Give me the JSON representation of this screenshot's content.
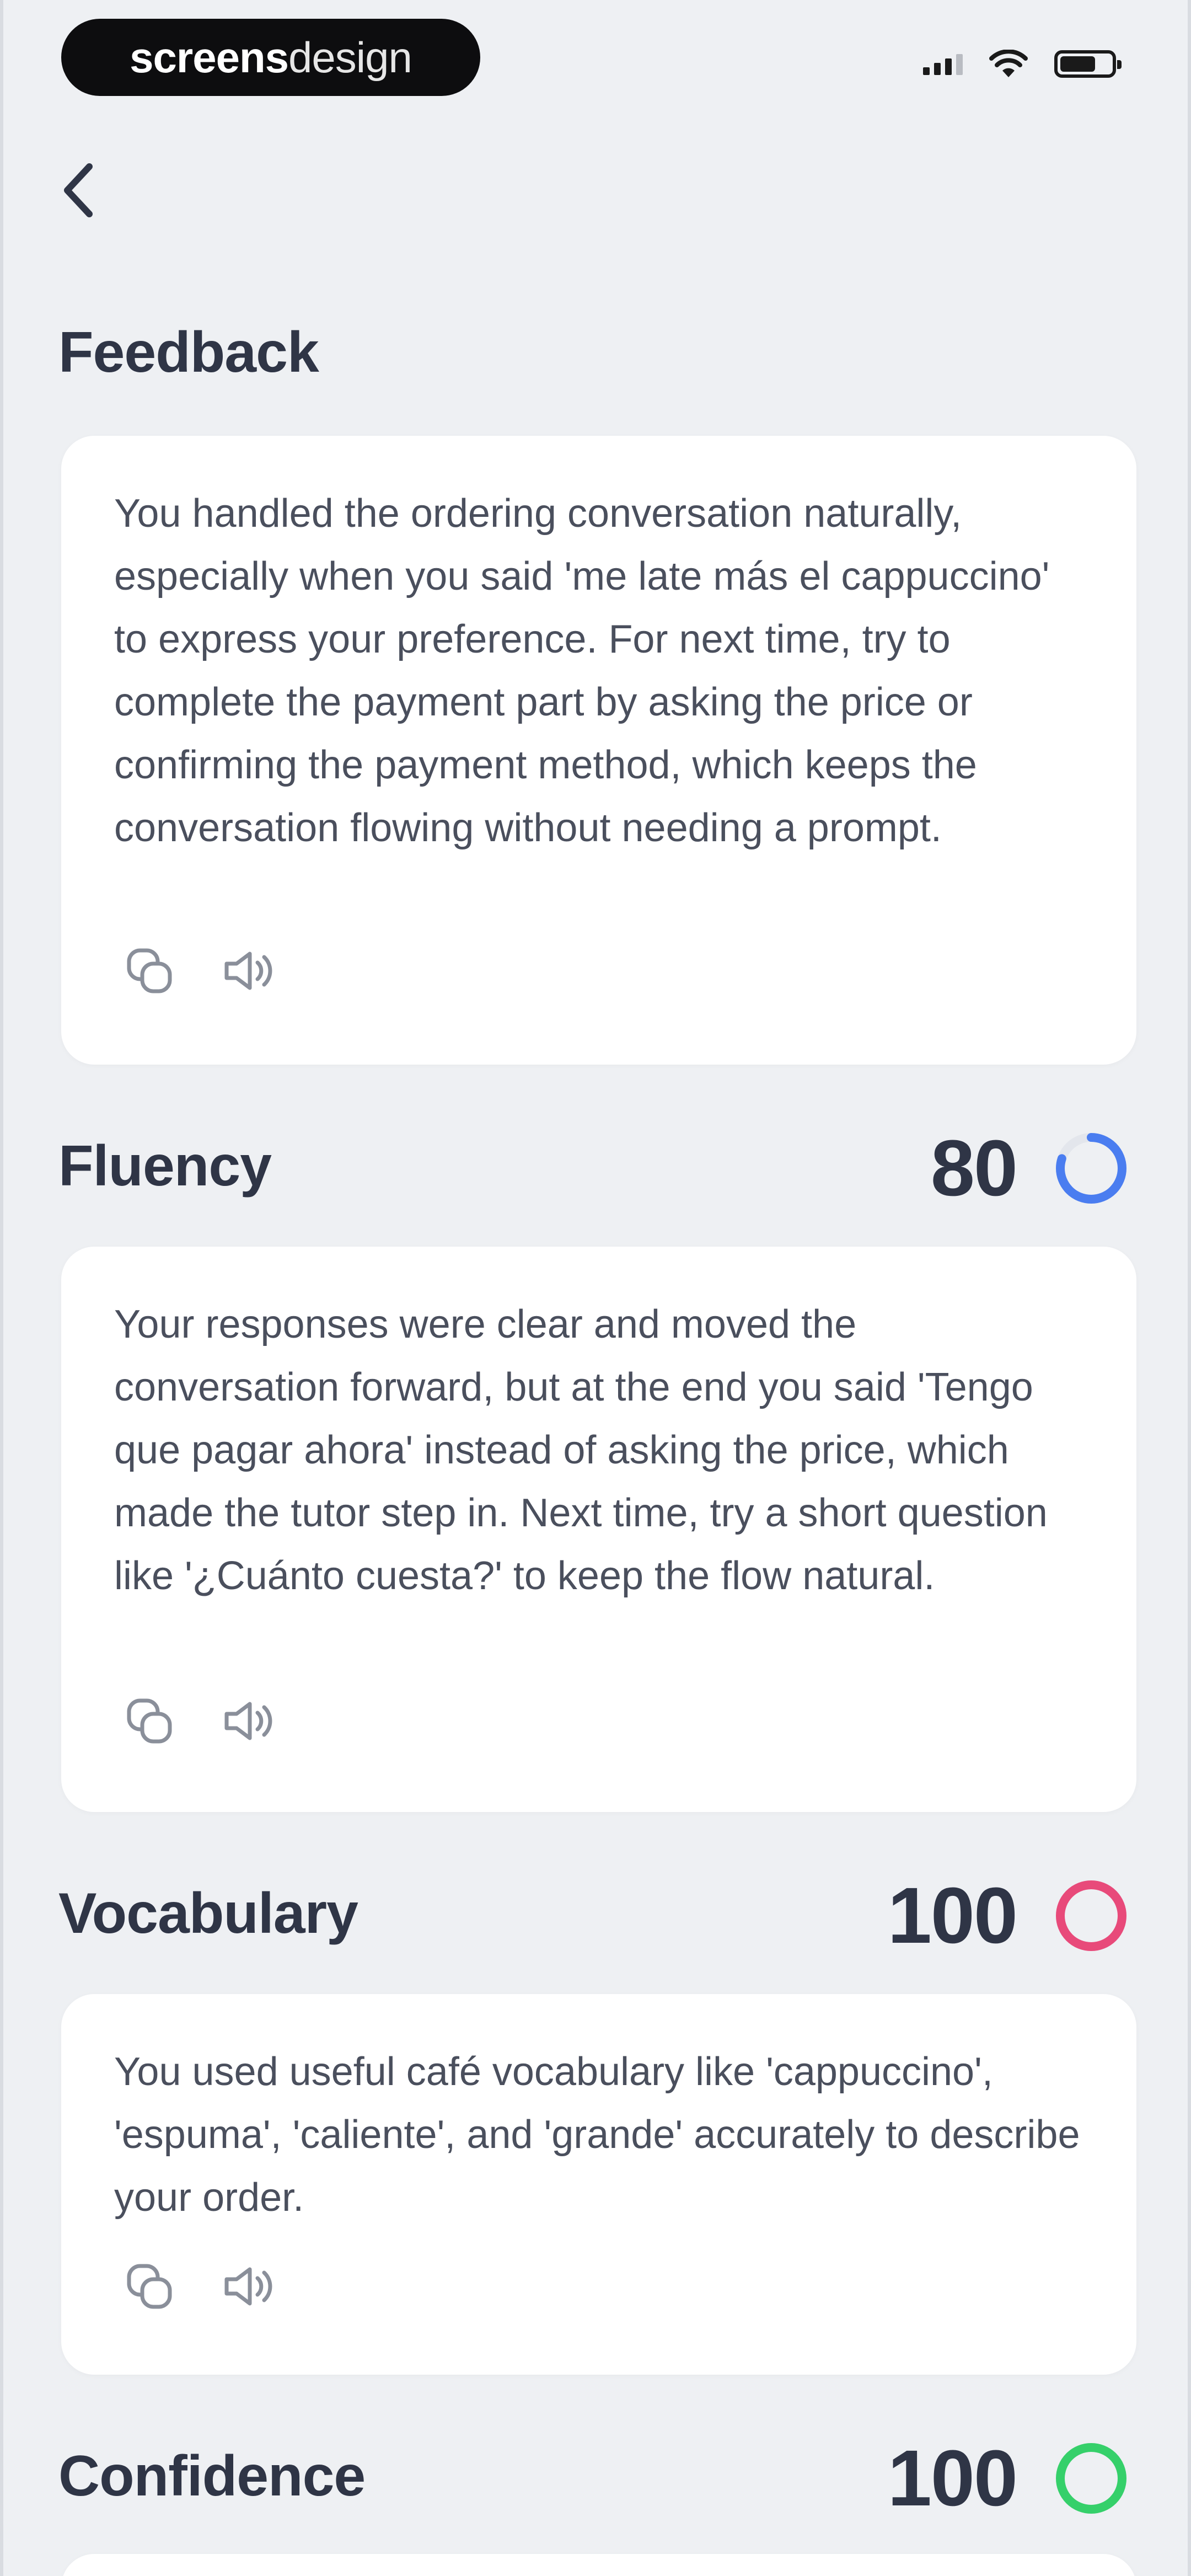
{
  "status_bar": {
    "brand_bold": "screens",
    "brand_light": "design"
  },
  "feedback": {
    "title": "Feedback",
    "text": "You handled the ordering conversation naturally, especially when you said 'me late más el cappuccino' to express your preference. For next time, try to complete the payment part by asking the price or confirming the payment method, which keeps the conversation flowing without needing a prompt."
  },
  "sections": [
    {
      "title": "Fluency",
      "score": "80",
      "score_fraction": 0.8,
      "ring_color": "#4a7df0",
      "text": "Your responses were clear and moved the conversation forward, but at the end you said 'Tengo que pagar ahora' instead of asking the price, which made the tutor step in. Next time, try a short question like '¿Cuánto cuesta?' to keep the flow natural."
    },
    {
      "title": "Vocabulary",
      "score": "100",
      "score_fraction": 1.0,
      "ring_color": "#e84a7a",
      "text": "You used useful café vocabulary like 'cappuccino', 'espuma', 'caliente', and 'grande' accurately to describe your order."
    },
    {
      "title": "Confidence",
      "score": "100",
      "score_fraction": 1.0,
      "ring_color": "#35d06a"
    }
  ],
  "icons": {
    "back": "chevron-left-icon",
    "translate": "translate-icon",
    "speaker": "speaker-icon"
  }
}
